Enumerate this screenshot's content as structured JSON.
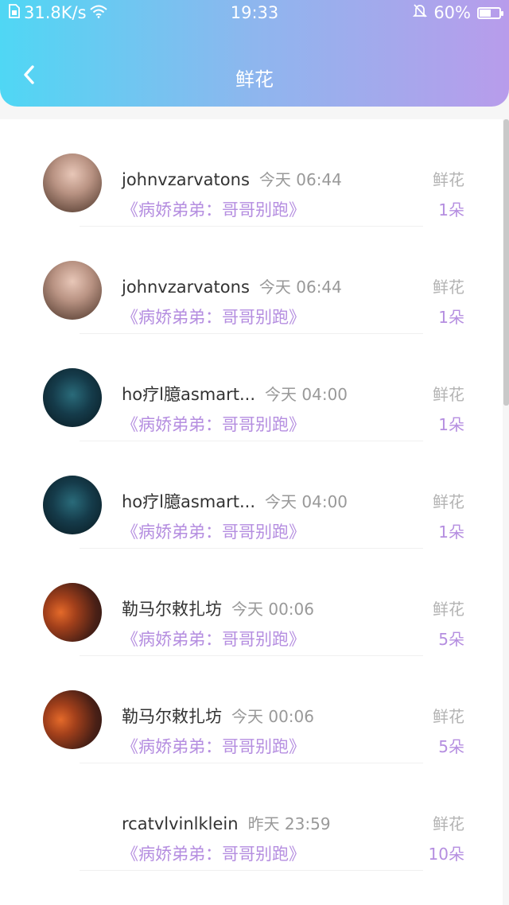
{
  "status_bar": {
    "speed": "31.8K/s",
    "time": "19:33",
    "battery": "60%",
    "battery_level": 0.6
  },
  "header": {
    "title": "鲜花",
    "back_icon": "chevron-left-icon"
  },
  "colors": {
    "header_gradient_start": "#4fd7f4",
    "header_gradient_end": "#b89ceb",
    "accent_purple": "#b58ee0"
  },
  "records": [
    {
      "name": "johnvzarvatons",
      "time": "今天 06:44",
      "book": "《病娇弟弟：哥哥别跑》",
      "gift_label": "鲜花",
      "count": "1朵"
    },
    {
      "name": "johnvzarvatons",
      "time": "今天 06:44",
      "book": "《病娇弟弟：哥哥别跑》",
      "gift_label": "鲜花",
      "count": "1朵"
    },
    {
      "name": "ho疗l臆asmart...",
      "time": "今天 04:00",
      "book": "《病娇弟弟：哥哥别跑》",
      "gift_label": "鲜花",
      "count": "1朵"
    },
    {
      "name": "ho疗l臆asmart...",
      "time": "今天 04:00",
      "book": "《病娇弟弟：哥哥别跑》",
      "gift_label": "鲜花",
      "count": "1朵"
    },
    {
      "name": "勒马尔敕扎坊",
      "time": "今天 00:06",
      "book": "《病娇弟弟：哥哥别跑》",
      "gift_label": "鲜花",
      "count": "5朵"
    },
    {
      "name": "勒马尔敕扎坊",
      "time": "今天 00:06",
      "book": "《病娇弟弟：哥哥别跑》",
      "gift_label": "鲜花",
      "count": "5朵"
    },
    {
      "name": "rcatvlvinlklein",
      "time": "昨天 23:59",
      "book": "《病娇弟弟：哥哥别跑》",
      "gift_label": "鲜花",
      "count": "10朵"
    }
  ]
}
